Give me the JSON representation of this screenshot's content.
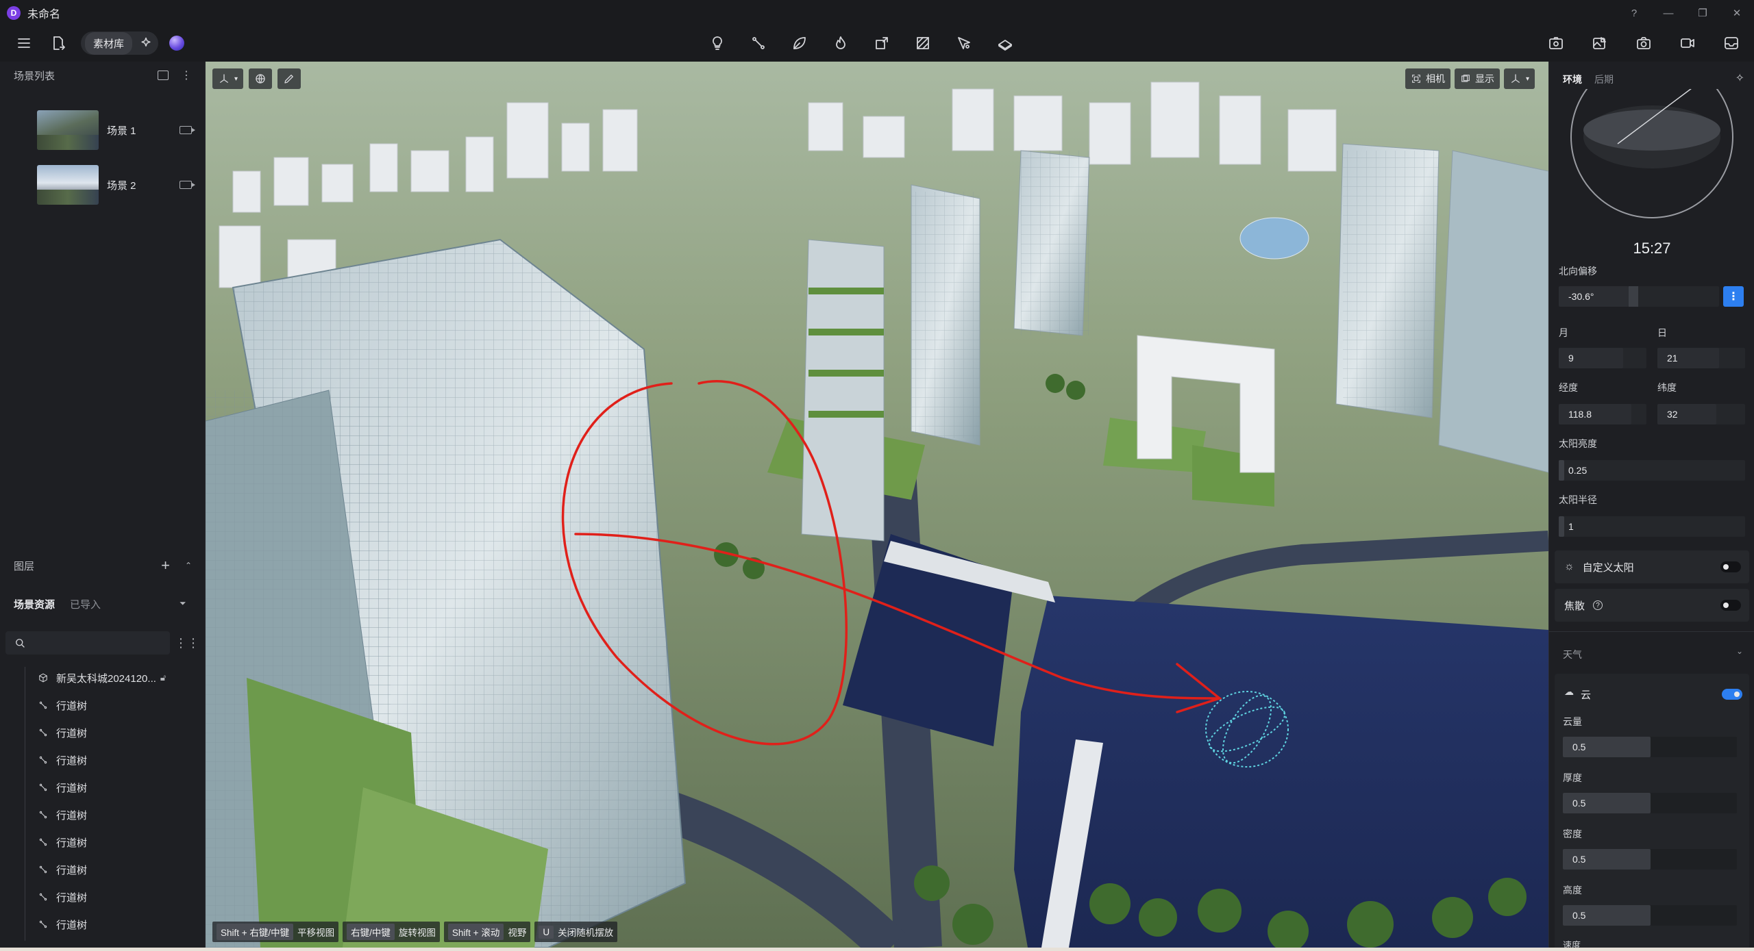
{
  "app": {
    "title": "未命名",
    "logo_letter": "D"
  },
  "window_controls": [
    "?",
    "—",
    "❐",
    "✕"
  ],
  "toolbar": {
    "library_label": "素材库",
    "center_icons": [
      "lightbulb-icon",
      "path-icon",
      "leaf-icon",
      "fire-icon",
      "box-move-icon",
      "texture-icon",
      "pointer-star-icon",
      "terrain-icon"
    ],
    "right_icons": [
      "camera-grid-icon",
      "image-edit-icon",
      "screenshot-icon",
      "video-icon",
      "inbox-icon"
    ]
  },
  "scene_list": {
    "title": "场景列表",
    "items": [
      {
        "name": "场景 1"
      },
      {
        "name": "场景 2"
      }
    ]
  },
  "layers": {
    "title": "图层",
    "tabs": [
      "场景资源",
      "已导入"
    ],
    "search_placeholder": "",
    "tree": [
      {
        "label": "新吴太科城2024120...",
        "icon": "cube-icon"
      },
      {
        "label": "行道树",
        "icon": "branch-icon"
      },
      {
        "label": "行道树",
        "icon": "branch-icon"
      },
      {
        "label": "行道树",
        "icon": "branch-icon"
      },
      {
        "label": "行道树",
        "icon": "branch-icon"
      },
      {
        "label": "行道树",
        "icon": "branch-icon"
      },
      {
        "label": "行道树",
        "icon": "branch-icon"
      },
      {
        "label": "行道树",
        "icon": "branch-icon"
      },
      {
        "label": "行道树",
        "icon": "branch-icon"
      },
      {
        "label": "行道树",
        "icon": "branch-icon"
      }
    ]
  },
  "viewport": {
    "top_right_buttons": [
      "相机",
      "显示"
    ],
    "hints": [
      {
        "key": "Shift + 右键/中键",
        "action": "平移视图"
      },
      {
        "key": "右键/中键",
        "action": "旋转视图"
      },
      {
        "key": "Shift + 滚动",
        "action": "视野"
      },
      {
        "key": "U",
        "action": "关闭随机摆放"
      }
    ]
  },
  "right_panel": {
    "tabs": [
      "环境",
      "后期"
    ],
    "time": "15:27",
    "north_offset_label": "北向偏移",
    "north_offset_value": "-30.6°",
    "month_label": "月",
    "month_value": "9",
    "day_label": "日",
    "day_value": "21",
    "longitude_label": "经度",
    "longitude_value": "118.8",
    "latitude_label": "纬度",
    "latitude_value": "32",
    "sun_brightness_label": "太阳亮度",
    "sun_brightness_value": "0.25",
    "sun_radius_label": "太阳半径",
    "sun_radius_value": "1",
    "custom_sun_label": "自定义太阳",
    "custom_sun_on": false,
    "caustics_label": "焦散",
    "caustics_on": false,
    "weather_label": "天气",
    "cloud_label": "云",
    "cloud_on": true,
    "cloud_amount_label": "云量",
    "cloud_amount_value": "0.5",
    "thickness_label": "厚度",
    "thickness_value": "0.5",
    "density_label": "密度",
    "density_value": "0.5",
    "height_label": "高度",
    "height_value": "0.5",
    "speed_label": "速度"
  },
  "colors": {
    "accent": "#2d7ff0",
    "panel": "#1e1f23",
    "annotation": "#e0201a"
  }
}
